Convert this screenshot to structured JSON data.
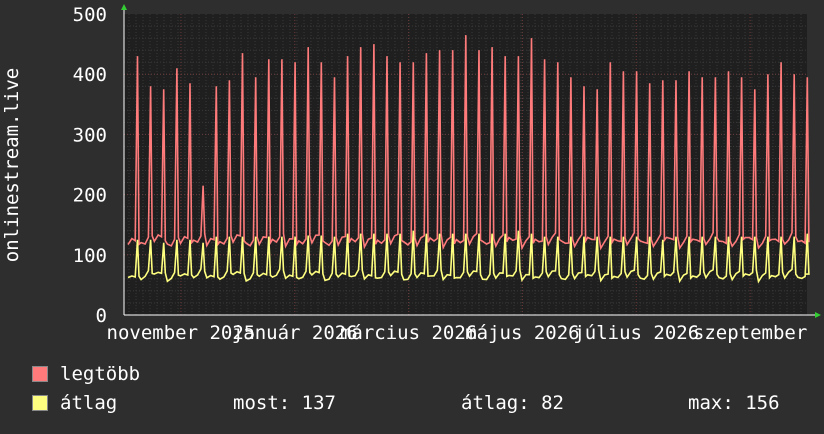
{
  "chart_data": {
    "type": "line",
    "ylabel": "onlinestream.live",
    "ylim": [
      0,
      500
    ],
    "y_ticks": [
      "0",
      "100",
      "200",
      "300",
      "400",
      "500"
    ],
    "x_tick_labels": [
      "november 2025",
      "január 2026",
      "március 2026",
      "május 2026",
      "július 2026",
      "szeptember"
    ],
    "grid": true,
    "series": [
      {
        "name": "legtöbb",
        "color": "#ff7b7b",
        "base_level": 120,
        "peaks": [
          430,
          380,
          375,
          410,
          385,
          215,
          380,
          390,
          435,
          395,
          425,
          425,
          420,
          445,
          420,
          395,
          430,
          445,
          450,
          430,
          420,
          420,
          435,
          440,
          440,
          465,
          440,
          445,
          430,
          430,
          460,
          425,
          420,
          395,
          380,
          375,
          420,
          405,
          405,
          385,
          390,
          390,
          405,
          395,
          395,
          405,
          395,
          375,
          400,
          420,
          400,
          395
        ]
      },
      {
        "name": "átlag",
        "color": "#ffff80",
        "base_level": 62,
        "peaks": [
          125,
          125,
          120,
          125,
          125,
          120,
          130,
          130,
          130,
          130,
          130,
          130,
          130,
          132,
          132,
          130,
          135,
          135,
          135,
          135,
          135,
          140,
          135,
          135,
          135,
          135,
          135,
          135,
          135,
          140,
          135,
          130,
          130,
          130,
          130,
          130,
          130,
          130,
          130,
          130,
          125,
          130,
          130,
          130,
          130,
          130,
          130,
          130,
          130,
          130,
          130,
          135
        ]
      }
    ]
  },
  "legend": [
    {
      "label": "legtöbb",
      "color": "#ff7b7b"
    },
    {
      "label": "átlag",
      "color": "#ffff80"
    }
  ],
  "stats": {
    "most": "most: 137",
    "atlag": "átlag: 82",
    "max": "max: 156"
  }
}
